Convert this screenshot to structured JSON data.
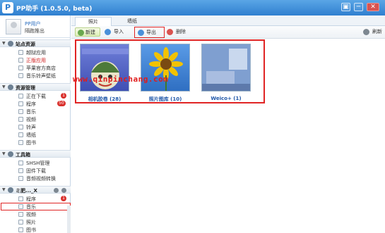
{
  "window": {
    "title": "PP助手 (1.0.5.0, beta)",
    "logo_letter": "P",
    "controls": {
      "menu": "▣",
      "minimize": "─",
      "close": "✕"
    }
  },
  "user": {
    "name": "PP用户",
    "logout": "隔跑推出"
  },
  "sidebar": {
    "sections": [
      {
        "label": "站点资源",
        "items": [
          {
            "label": "越狱应用"
          },
          {
            "label": "正版应用"
          },
          {
            "label": "苹果官方商店"
          },
          {
            "label": "音乐铃声壁纸"
          }
        ]
      },
      {
        "label": "资源管理",
        "items": [
          {
            "label": "正在下载",
            "badge": "1"
          },
          {
            "label": "程序",
            "badge": "50"
          },
          {
            "label": "音乐"
          },
          {
            "label": "视频"
          },
          {
            "label": "铃声"
          },
          {
            "label": "墙纸"
          },
          {
            "label": "图书"
          }
        ]
      },
      {
        "label": "工具箱",
        "items": [
          {
            "label": "SHSH管理"
          },
          {
            "label": "固件下载"
          },
          {
            "label": "音频视频转换"
          }
        ]
      },
      {
        "label": "ミ肥..._X",
        "items": [
          {
            "label": "程序",
            "badge": "1"
          },
          {
            "label": "音乐"
          },
          {
            "label": "视频"
          },
          {
            "label": "照片"
          },
          {
            "label": "图书"
          }
        ]
      }
    ]
  },
  "tabs": [
    {
      "label": "照片"
    },
    {
      "label": "墙纸"
    }
  ],
  "toolbar": {
    "new_label": "新建",
    "import_label": "导入",
    "export_label": "导出",
    "delete_label": "删除",
    "refresh_label": "刷新"
  },
  "albums": [
    {
      "caption": "相机胶卷 (28)"
    },
    {
      "caption": "照片图库 (10)"
    },
    {
      "caption": "Weico+ (1)"
    }
  ],
  "watermark": "www.qinpinchang.com",
  "colors": {
    "accent": "#2f7fd0",
    "highlight": "#e02424",
    "badge": "#d9302c",
    "caption": "#1f57a8"
  }
}
